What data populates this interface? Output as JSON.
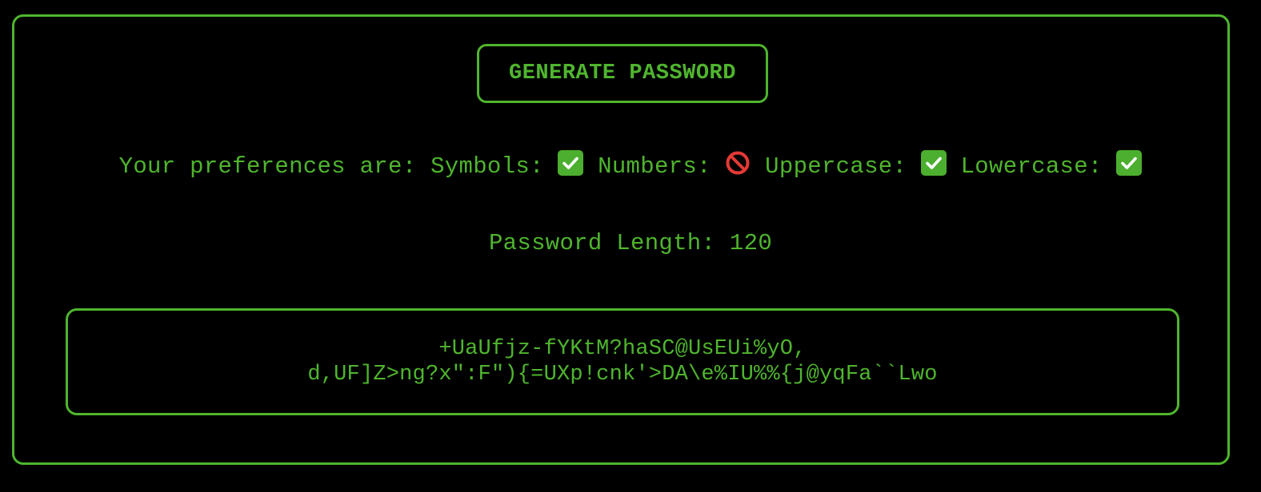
{
  "generate_button": {
    "label": "GENERATE PASSWORD"
  },
  "preferences": {
    "intro": "Your preferences are:",
    "items": [
      {
        "label": "Symbols:",
        "enabled": true,
        "icon": "check-mark-icon"
      },
      {
        "label": "Numbers:",
        "enabled": false,
        "icon": "no-entry-icon"
      },
      {
        "label": "Uppercase:",
        "enabled": true,
        "icon": "check-mark-icon"
      },
      {
        "label": "Lowercase:",
        "enabled": true,
        "icon": "check-mark-icon"
      }
    ]
  },
  "length": {
    "label": "Password Length: 120"
  },
  "output": {
    "password_line1": "+UaUfjz-fYKtM?haSC@UsEUi%yO,",
    "password_line2": "d,UF]Z>ng?x\":F\"){=UXp!cnk'>DA\\e%IU%%{j@yqFa``Lwo"
  },
  "colors": {
    "accent": "#4fb52e",
    "background": "#000000",
    "check": "#4caf2f",
    "no_entry": "#e53935"
  }
}
